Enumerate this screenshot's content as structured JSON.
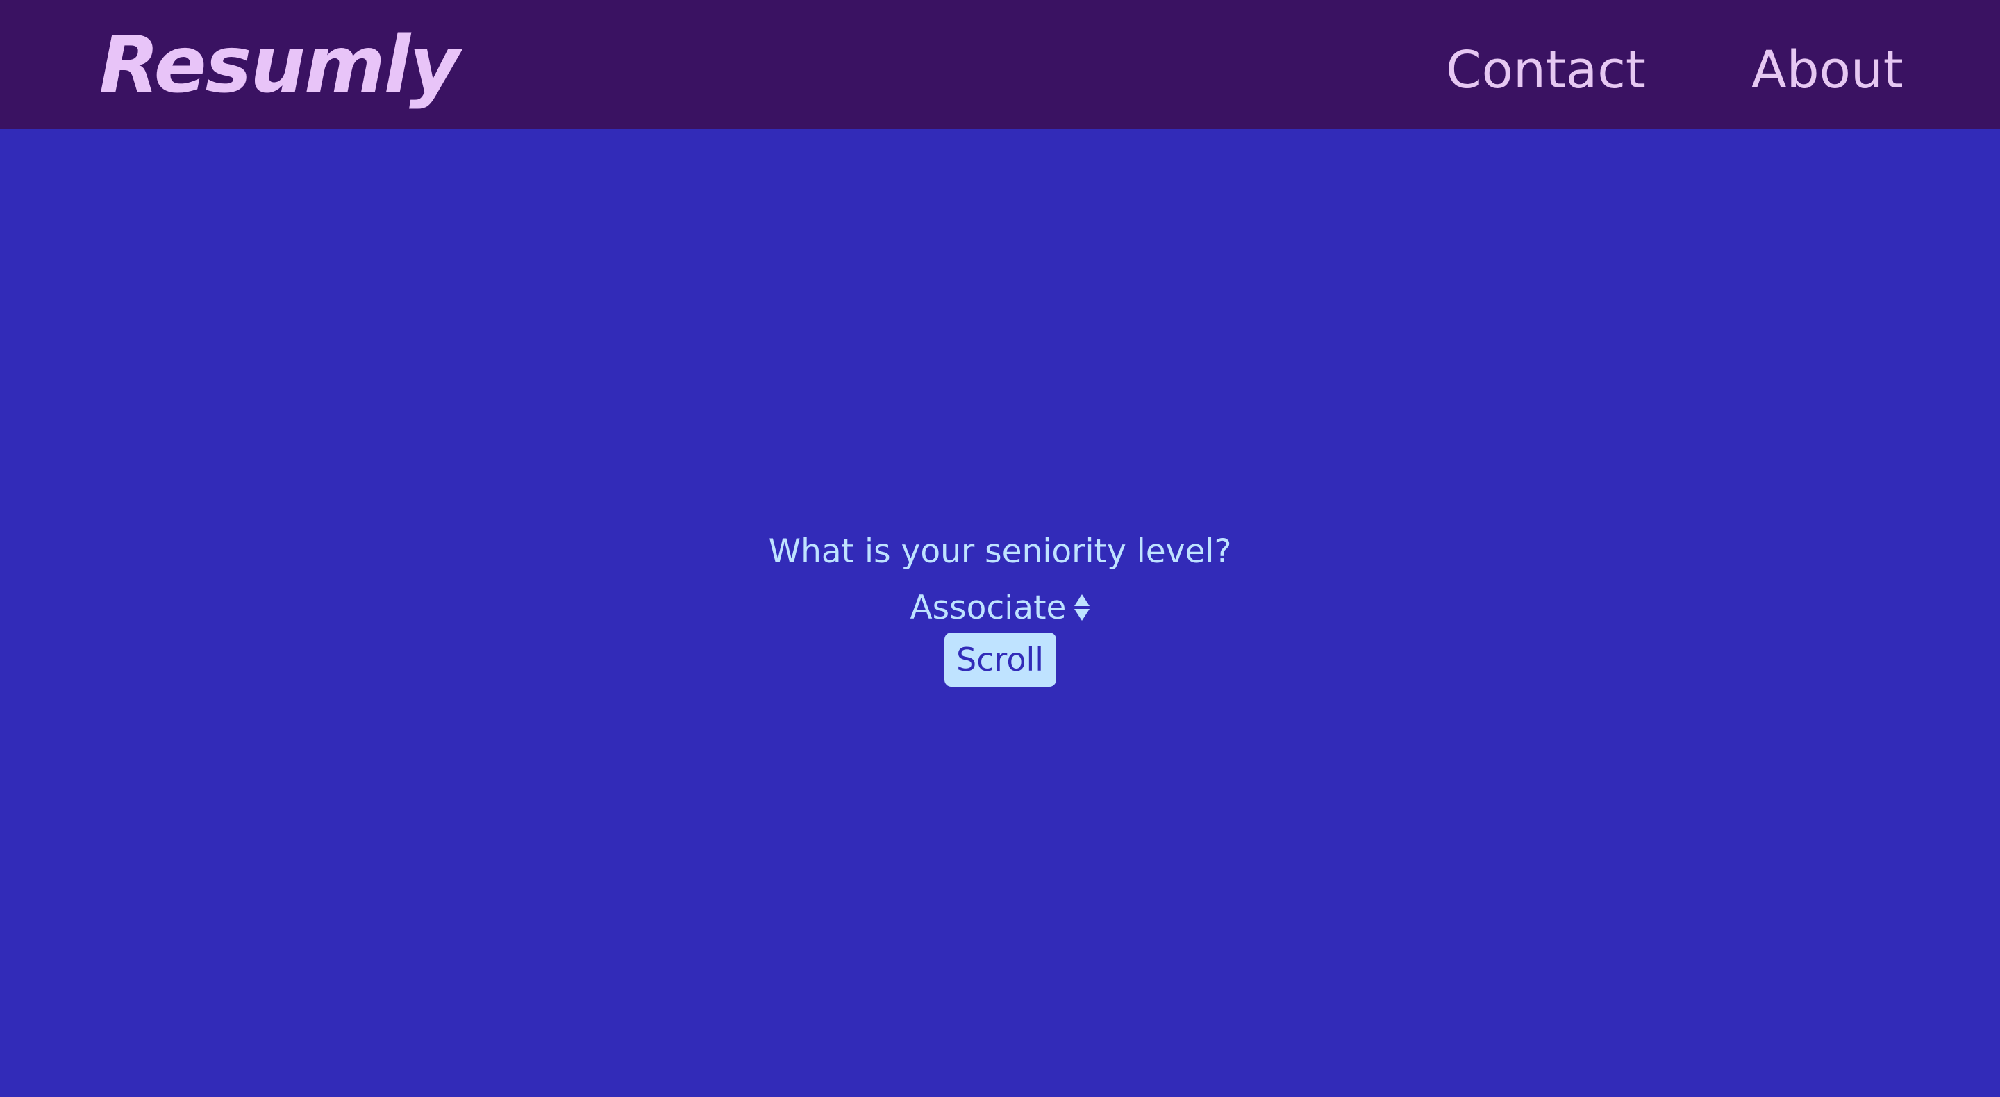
{
  "header": {
    "logo": "Resumly",
    "nav": [
      {
        "label": "Contact"
      },
      {
        "label": "About"
      }
    ]
  },
  "main": {
    "question": "What is your seniority level?",
    "seniority_select": {
      "selected": "Associate",
      "icon": "select-arrows-icon"
    },
    "scroll_button": "Scroll"
  },
  "colors": {
    "header_bg": "#3a1262",
    "page_bg": "#322bb8",
    "logo": "#e8c4f8",
    "nav_text": "#e6c8f2",
    "accent": "#bfe3ff"
  }
}
